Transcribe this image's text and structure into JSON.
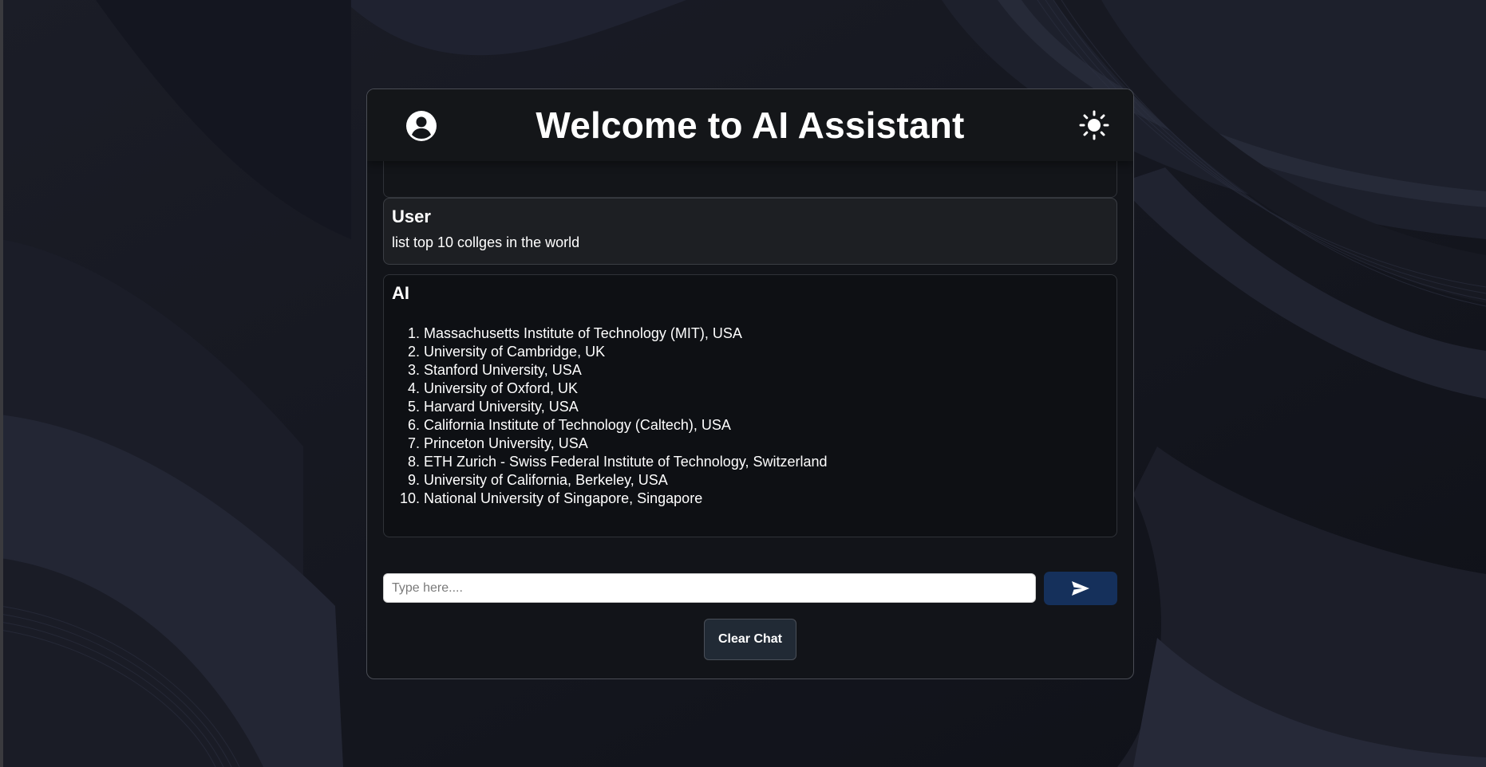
{
  "header": {
    "title": "Welcome to AI Assistant",
    "profile_icon": "user-circle-icon",
    "theme_icon": "sun-icon"
  },
  "messages": [
    {
      "sender": "User",
      "text": "list top 10 collges in the world"
    },
    {
      "sender": "AI",
      "items": [
        "Massachusetts Institute of Technology (MIT), USA",
        "University of Cambridge, UK",
        "Stanford University, USA",
        "University of Oxford, UK",
        "Harvard University, USA",
        "California Institute of Technology (Caltech), USA",
        "Princeton University, USA",
        "ETH Zurich - Swiss Federal Institute of Technology, Switzerland",
        "University of California, Berkeley, USA",
        "National University of Singapore, Singapore"
      ]
    }
  ],
  "composer": {
    "placeholder": "Type here....",
    "value": "",
    "send_icon": "send-icon"
  },
  "actions": {
    "clear_label": "Clear Chat"
  },
  "colors": {
    "background": "#15171f",
    "panel": "#121419",
    "send_button": "#15305b",
    "clear_button": "#212a35"
  }
}
